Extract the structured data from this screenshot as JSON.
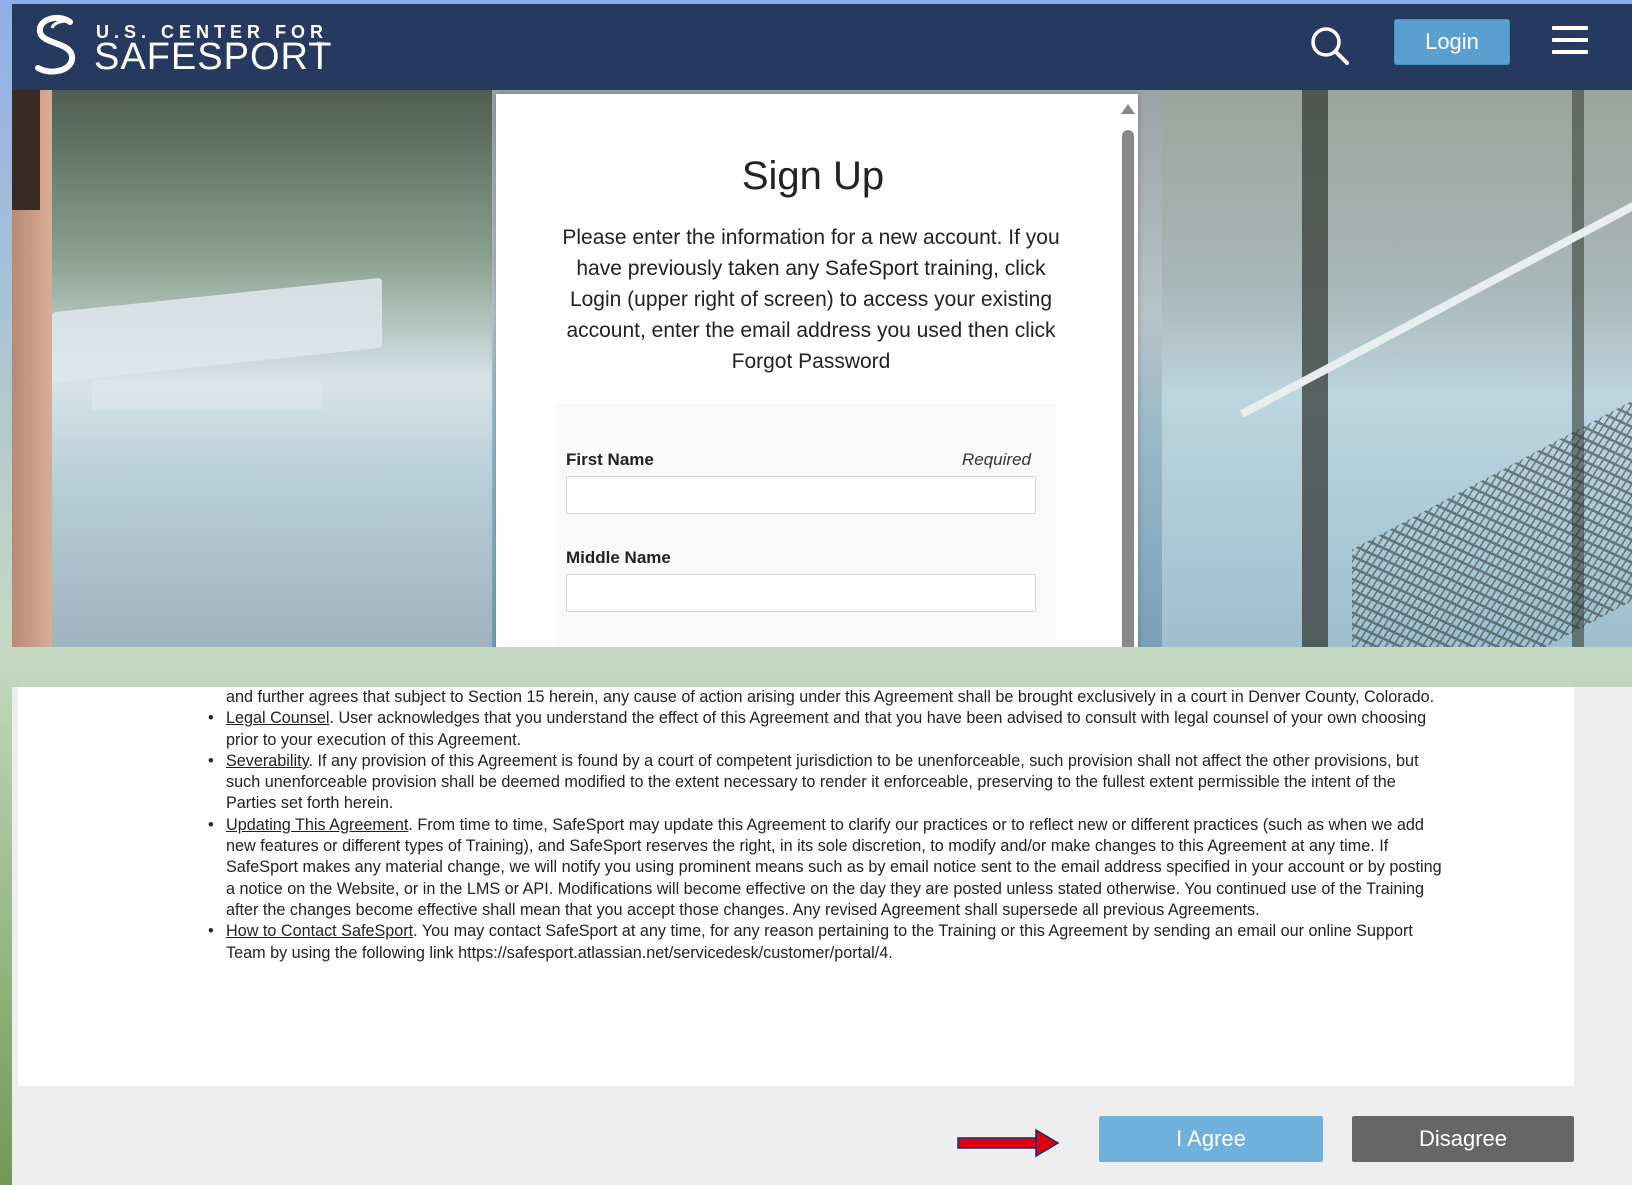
{
  "header": {
    "logo_line1": "U.S. CENTER FOR",
    "logo_line2": "SAFESPORT",
    "logo_tm": "™",
    "login_label": "Login",
    "search_icon": "search-icon",
    "menu_icon": "hamburger-menu-icon",
    "background_color": "#253a5e",
    "login_color": "#5a9fd0"
  },
  "signup": {
    "title": "Sign Up",
    "intro": "Please enter the information for a new account. If you have previously taken any SafeSport training, click Login (upper right of screen) to access your existing account, enter the email address you used then click Forgot Password",
    "fields": [
      {
        "label": "First Name",
        "required_text": "Required",
        "value": ""
      },
      {
        "label": "Middle Name",
        "value": ""
      }
    ]
  },
  "agreement": {
    "lead_text": "and further agrees that subject to Section 15 herein, any cause of action arising under this Agreement shall be brought exclusively in a court in Denver County, Colorado.",
    "items": [
      {
        "term": "Legal Counsel",
        "text": ". User acknowledges that you understand the effect of this Agreement and that you have been advised to consult with legal counsel of your own choosing prior to your execution of this Agreement."
      },
      {
        "term": "Severability",
        "text": ". If any provision of this Agreement is found by a court of competent jurisdiction to be unenforceable, such provision shall not affect the other provisions, but such unenforceable provision shall be deemed modified to the extent necessary to render it enforceable, preserving to the fullest extent permissible the intent of the Parties set forth herein."
      },
      {
        "term": "Updating This Agreement",
        "text": ". From time to time, SafeSport may update this Agreement to clarify our practices or to reflect new or different practices (such as when we add new features or different types of Training), and SafeSport reserves the right, in its sole discretion, to modify and/or make changes to this Agreement at any time. If SafeSport makes any material change, we will notify you using prominent means such as by email notice sent to the email address specified in your account or by posting a notice on the Website, or in the LMS or API. Modifications will become effective on the day they are posted unless stated otherwise. You continued use of the Training after the changes become effective shall mean that you accept those changes. Any revised Agreement shall supersede all previous Agreements."
      },
      {
        "term": "How to Contact SafeSport",
        "text": ". You may contact SafeSport at any time, for any reason pertaining to the Training or this Agreement by sending an email our online Support Team by using the following link https://safesport.atlassian.net/servicedesk/customer/portal/4."
      }
    ],
    "agree_label": "I Agree",
    "disagree_label": "Disagree",
    "agree_color": "#6fb0dc",
    "disagree_color": "#666666",
    "arrow_color": "#e0000f"
  }
}
